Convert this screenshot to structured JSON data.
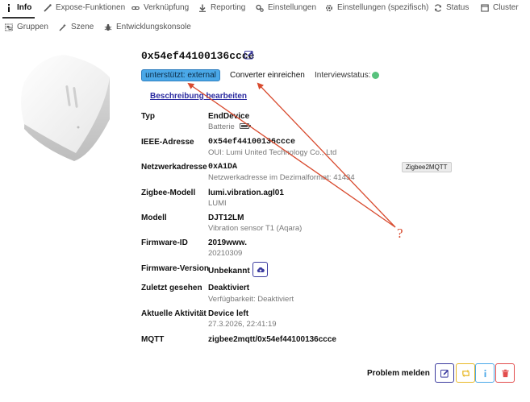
{
  "tabs_row1": [
    {
      "label": "Info",
      "icon": "info-icon",
      "active": true
    },
    {
      "label": "Expose-Funktionen",
      "icon": "magic-wand-icon"
    },
    {
      "label": "Verknüpfung",
      "icon": "link-icon"
    },
    {
      "label": "Reporting",
      "icon": "download-icon"
    },
    {
      "label": "Einstellungen",
      "icon": "cogs-icon"
    },
    {
      "label": "Einstellungen (spezifisch)",
      "icon": "gear-icon"
    },
    {
      "label": "Status",
      "icon": "sync-icon"
    },
    {
      "label": "Cluster",
      "icon": "window-icon"
    }
  ],
  "tabs_row2": [
    {
      "label": "Gruppen",
      "icon": "object-group-icon"
    },
    {
      "label": "Szene",
      "icon": "magic-icon"
    },
    {
      "label": "Entwicklungskonsole",
      "icon": "bug-icon"
    }
  ],
  "device": {
    "friendly_name": "0x54ef44100136ccce",
    "support_badge": "unterstützt: external",
    "converter_button": "Converter einreichen",
    "interview_label": "Interviewstatus:",
    "description_link": "Beschreibung bearbeiten",
    "tooltip": "Zigbee2MQTT"
  },
  "info_rows": {
    "typ": {
      "label": "Typ",
      "value": "EndDevice",
      "sub": "Batterie"
    },
    "ieee": {
      "label": "IEEE-Adresse",
      "value": "0x54ef44100136ccce",
      "sub": "OUI: Lumi United Technology Co., Ltd"
    },
    "netz": {
      "label": "Netzwerkadresse",
      "value": "0xA1DA",
      "sub": "Netzwerkadresse im Dezimalformat: 41434"
    },
    "zigmodel": {
      "label": "Zigbee-Modell",
      "value": "lumi.vibration.agl01",
      "sub": "LUMI"
    },
    "modell": {
      "label": "Modell",
      "value": "DJT12LM",
      "sub": "Vibration sensor T1 (Aqara)"
    },
    "fwid": {
      "label": "Firmware-ID",
      "value": "2019www.",
      "sub": "20210309"
    },
    "fwver": {
      "label": "Firmware-Version",
      "value": "Unbekannt"
    },
    "seen": {
      "label": "Zuletzt gesehen",
      "value": "Deaktiviert",
      "sub": "Verfügbarkeit: Deaktiviert"
    },
    "activity": {
      "label": "Aktuelle Aktivität",
      "value": "Device left",
      "sub": "27.3.2026, 22:41:19"
    },
    "mqtt": {
      "label": "MQTT",
      "value": "zigbee2mqtt/0x54ef44100136ccce"
    }
  },
  "footer": {
    "problem_label": "Problem melden"
  },
  "annotation": {
    "text": "?"
  },
  "colors": {
    "accent": "#3b3b9f",
    "badge": "#4aa8e8",
    "success": "#58c27d",
    "annotation": "#d84a2e",
    "warning": "#e8b826",
    "danger": "#e24d4d"
  }
}
